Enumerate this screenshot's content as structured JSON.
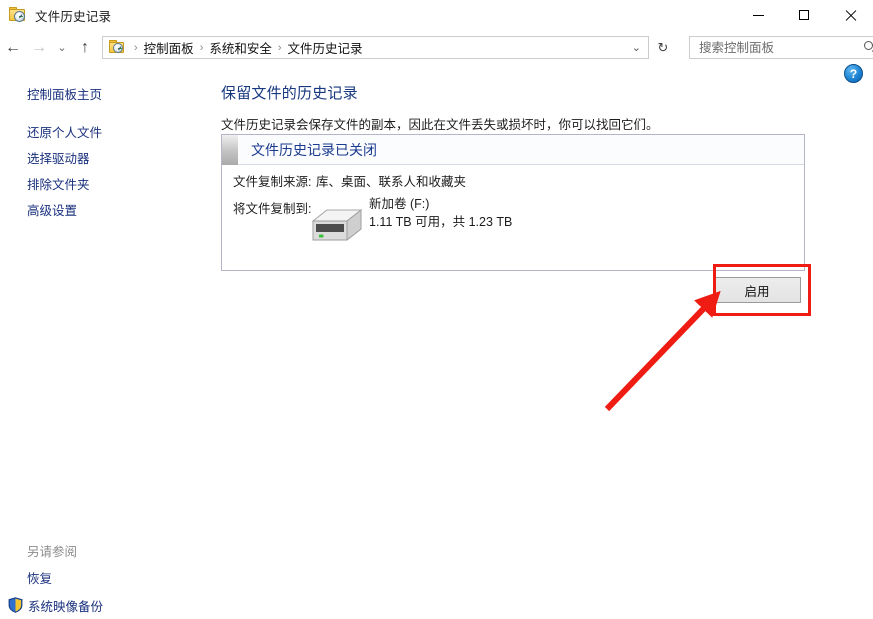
{
  "window": {
    "title": "文件历史记录",
    "icon": "file-history-icon",
    "controls": {
      "minimize": "–",
      "maximize": "▢",
      "close": "✕"
    }
  },
  "toolbar": {
    "back_icon": "←",
    "forward_icon": "→",
    "history_icon": "⌄",
    "up_icon": "↑",
    "refresh_icon": "↻",
    "address_chevron": "⌄",
    "breadcrumb": [
      "控制面板",
      "系统和安全",
      "文件历史记录"
    ],
    "breadcrumb_separator": "›"
  },
  "search": {
    "placeholder": "搜索控制面板",
    "value": "",
    "icon": "search-icon"
  },
  "help": {
    "label": "?",
    "icon": "help-icon"
  },
  "sidebar": {
    "home_label": "控制面板主页",
    "items": [
      {
        "label": "还原个人文件"
      },
      {
        "label": "选择驱动器"
      },
      {
        "label": "排除文件夹"
      },
      {
        "label": "高级设置"
      }
    ],
    "see_also": {
      "title": "另请参阅",
      "items": [
        {
          "label": "恢复",
          "icon": null
        },
        {
          "label": "系统映像备份",
          "icon": "shield-icon"
        }
      ]
    }
  },
  "main": {
    "page_title": "保留文件的历史记录",
    "page_description": "文件历史记录会保存文件的副本，因此在文件丢失或损坏时，你可以找回它们。",
    "panel": {
      "status_banner": "文件历史记录已关闭",
      "source_label": "文件复制来源:",
      "source_value": "库、桌面、联系人和收藏夹",
      "destination_label": "将文件复制到:",
      "drive": {
        "icon": "external-drive-icon",
        "name": "新加卷 (F:)",
        "space": "1.11 TB 可用，共 1.23 TB"
      }
    },
    "enable_button": "启用"
  },
  "annotations": {
    "highlight_color": "#ee1c12",
    "arrow_color": "#ee1c12",
    "target": "启用"
  },
  "colors": {
    "link": "#19307d",
    "page_title": "#17377f",
    "banner_text": "#1a3a8f",
    "annotation_red": "#ee1c12",
    "help_blue": "#1e84d4"
  }
}
